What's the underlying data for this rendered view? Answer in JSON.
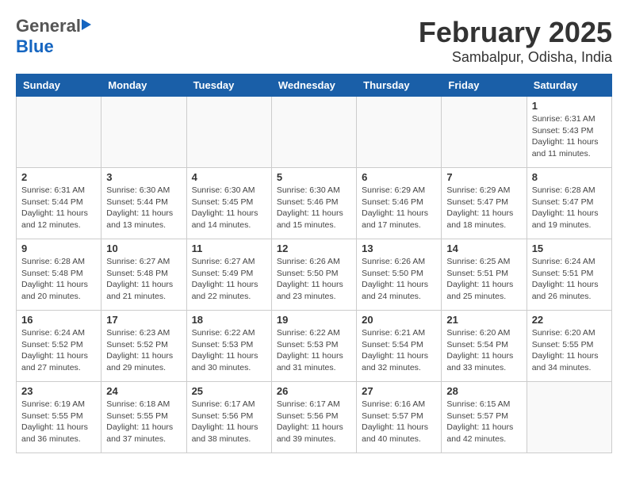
{
  "header": {
    "logo_general": "General",
    "logo_blue": "Blue",
    "month_title": "February 2025",
    "location": "Sambalpur, Odisha, India"
  },
  "weekdays": [
    "Sunday",
    "Monday",
    "Tuesday",
    "Wednesday",
    "Thursday",
    "Friday",
    "Saturday"
  ],
  "weeks": [
    [
      {
        "day": "",
        "info": ""
      },
      {
        "day": "",
        "info": ""
      },
      {
        "day": "",
        "info": ""
      },
      {
        "day": "",
        "info": ""
      },
      {
        "day": "",
        "info": ""
      },
      {
        "day": "",
        "info": ""
      },
      {
        "day": "1",
        "info": "Sunrise: 6:31 AM\nSunset: 5:43 PM\nDaylight: 11 hours and 11 minutes."
      }
    ],
    [
      {
        "day": "2",
        "info": "Sunrise: 6:31 AM\nSunset: 5:44 PM\nDaylight: 11 hours and 12 minutes."
      },
      {
        "day": "3",
        "info": "Sunrise: 6:30 AM\nSunset: 5:44 PM\nDaylight: 11 hours and 13 minutes."
      },
      {
        "day": "4",
        "info": "Sunrise: 6:30 AM\nSunset: 5:45 PM\nDaylight: 11 hours and 14 minutes."
      },
      {
        "day": "5",
        "info": "Sunrise: 6:30 AM\nSunset: 5:46 PM\nDaylight: 11 hours and 15 minutes."
      },
      {
        "day": "6",
        "info": "Sunrise: 6:29 AM\nSunset: 5:46 PM\nDaylight: 11 hours and 17 minutes."
      },
      {
        "day": "7",
        "info": "Sunrise: 6:29 AM\nSunset: 5:47 PM\nDaylight: 11 hours and 18 minutes."
      },
      {
        "day": "8",
        "info": "Sunrise: 6:28 AM\nSunset: 5:47 PM\nDaylight: 11 hours and 19 minutes."
      }
    ],
    [
      {
        "day": "9",
        "info": "Sunrise: 6:28 AM\nSunset: 5:48 PM\nDaylight: 11 hours and 20 minutes."
      },
      {
        "day": "10",
        "info": "Sunrise: 6:27 AM\nSunset: 5:48 PM\nDaylight: 11 hours and 21 minutes."
      },
      {
        "day": "11",
        "info": "Sunrise: 6:27 AM\nSunset: 5:49 PM\nDaylight: 11 hours and 22 minutes."
      },
      {
        "day": "12",
        "info": "Sunrise: 6:26 AM\nSunset: 5:50 PM\nDaylight: 11 hours and 23 minutes."
      },
      {
        "day": "13",
        "info": "Sunrise: 6:26 AM\nSunset: 5:50 PM\nDaylight: 11 hours and 24 minutes."
      },
      {
        "day": "14",
        "info": "Sunrise: 6:25 AM\nSunset: 5:51 PM\nDaylight: 11 hours and 25 minutes."
      },
      {
        "day": "15",
        "info": "Sunrise: 6:24 AM\nSunset: 5:51 PM\nDaylight: 11 hours and 26 minutes."
      }
    ],
    [
      {
        "day": "16",
        "info": "Sunrise: 6:24 AM\nSunset: 5:52 PM\nDaylight: 11 hours and 27 minutes."
      },
      {
        "day": "17",
        "info": "Sunrise: 6:23 AM\nSunset: 5:52 PM\nDaylight: 11 hours and 29 minutes."
      },
      {
        "day": "18",
        "info": "Sunrise: 6:22 AM\nSunset: 5:53 PM\nDaylight: 11 hours and 30 minutes."
      },
      {
        "day": "19",
        "info": "Sunrise: 6:22 AM\nSunset: 5:53 PM\nDaylight: 11 hours and 31 minutes."
      },
      {
        "day": "20",
        "info": "Sunrise: 6:21 AM\nSunset: 5:54 PM\nDaylight: 11 hours and 32 minutes."
      },
      {
        "day": "21",
        "info": "Sunrise: 6:20 AM\nSunset: 5:54 PM\nDaylight: 11 hours and 33 minutes."
      },
      {
        "day": "22",
        "info": "Sunrise: 6:20 AM\nSunset: 5:55 PM\nDaylight: 11 hours and 34 minutes."
      }
    ],
    [
      {
        "day": "23",
        "info": "Sunrise: 6:19 AM\nSunset: 5:55 PM\nDaylight: 11 hours and 36 minutes."
      },
      {
        "day": "24",
        "info": "Sunrise: 6:18 AM\nSunset: 5:55 PM\nDaylight: 11 hours and 37 minutes."
      },
      {
        "day": "25",
        "info": "Sunrise: 6:17 AM\nSunset: 5:56 PM\nDaylight: 11 hours and 38 minutes."
      },
      {
        "day": "26",
        "info": "Sunrise: 6:17 AM\nSunset: 5:56 PM\nDaylight: 11 hours and 39 minutes."
      },
      {
        "day": "27",
        "info": "Sunrise: 6:16 AM\nSunset: 5:57 PM\nDaylight: 11 hours and 40 minutes."
      },
      {
        "day": "28",
        "info": "Sunrise: 6:15 AM\nSunset: 5:57 PM\nDaylight: 11 hours and 42 minutes."
      },
      {
        "day": "",
        "info": ""
      }
    ]
  ]
}
